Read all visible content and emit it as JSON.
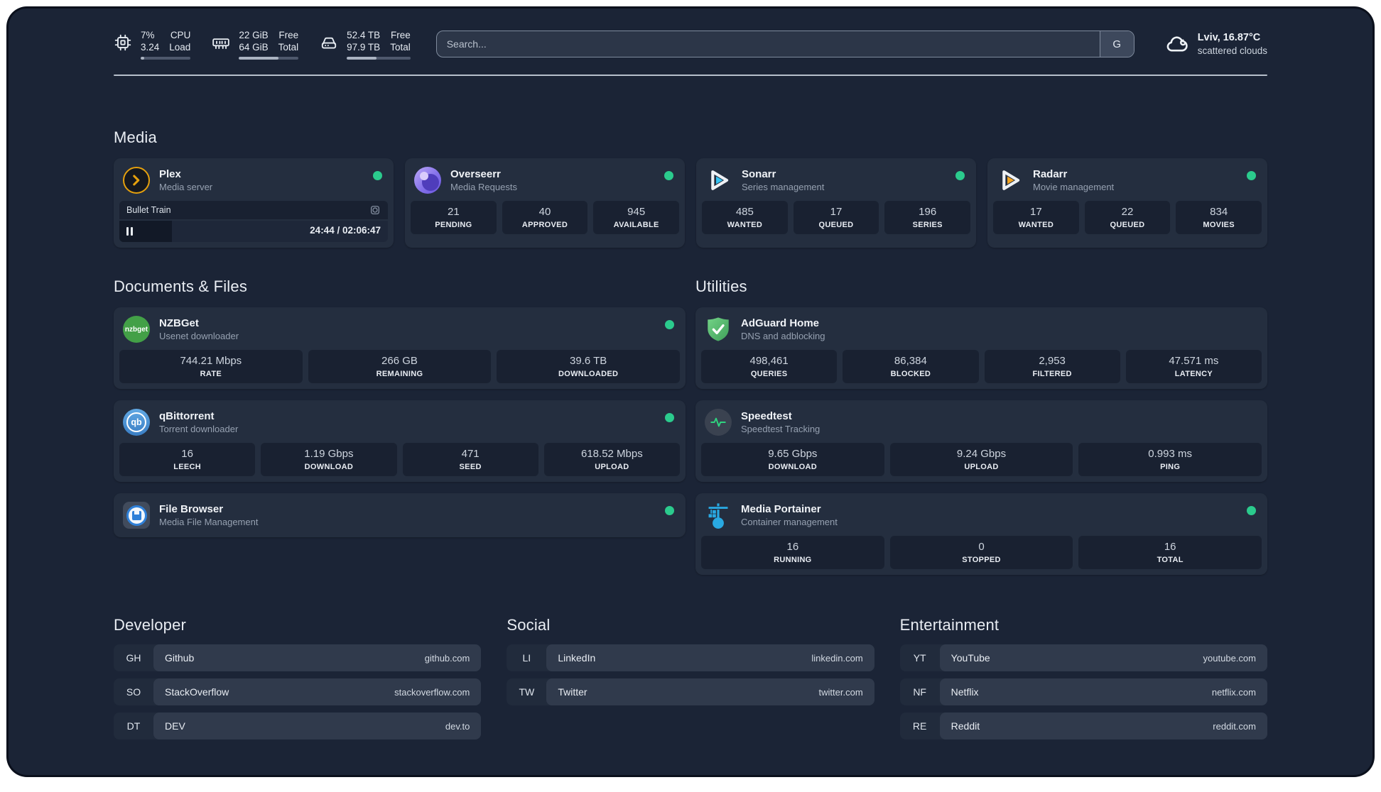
{
  "header": {
    "resources": [
      {
        "v1": "7%",
        "v2": "3.24",
        "l1": "CPU",
        "l2": "Load",
        "pct": 7
      },
      {
        "v1": "22 GiB",
        "v2": "64 GiB",
        "l1": "Free",
        "l2": "Total",
        "pct": 66
      },
      {
        "v1": "52.4 TB",
        "v2": "97.9 TB",
        "l1": "Free",
        "l2": "Total",
        "pct": 47
      }
    ],
    "search": {
      "placeholder": "Search...",
      "provider_label": "G"
    },
    "weather": {
      "location": "Lviv, 16.87°C",
      "condition": "scattered clouds"
    }
  },
  "sections": {
    "media": "Media",
    "documents": "Documents & Files",
    "utilities": "Utilities",
    "developer": "Developer",
    "social": "Social",
    "entertainment": "Entertainment"
  },
  "services": {
    "plex": {
      "name": "Plex",
      "desc": "Media server",
      "status": "online",
      "player": {
        "title": "Bullet Train",
        "time": "24:44 / 02:06:47",
        "progress_pct": 19.5
      }
    },
    "overseerr": {
      "name": "Overseerr",
      "desc": "Media Requests",
      "status": "online",
      "stats": [
        {
          "value": "21",
          "label": "PENDING"
        },
        {
          "value": "40",
          "label": "APPROVED"
        },
        {
          "value": "945",
          "label": "AVAILABLE"
        }
      ]
    },
    "sonarr": {
      "name": "Sonarr",
      "desc": "Series management",
      "status": "online",
      "stats": [
        {
          "value": "485",
          "label": "WANTED"
        },
        {
          "value": "17",
          "label": "QUEUED"
        },
        {
          "value": "196",
          "label": "SERIES"
        }
      ]
    },
    "radarr": {
      "name": "Radarr",
      "desc": "Movie management",
      "status": "online",
      "stats": [
        {
          "value": "17",
          "label": "WANTED"
        },
        {
          "value": "22",
          "label": "QUEUED"
        },
        {
          "value": "834",
          "label": "MOVIES"
        }
      ]
    },
    "nzbget": {
      "name": "NZBGet",
      "desc": "Usenet downloader",
      "status": "online",
      "icon_text": "nzbget",
      "stats": [
        {
          "value": "744.21 Mbps",
          "label": "RATE"
        },
        {
          "value": "266 GB",
          "label": "REMAINING"
        },
        {
          "value": "39.6 TB",
          "label": "DOWNLOADED"
        }
      ]
    },
    "qbittorrent": {
      "name": "qBittorrent",
      "desc": "Torrent downloader",
      "status": "online",
      "icon_text": "qb",
      "stats": [
        {
          "value": "16",
          "label": "LEECH"
        },
        {
          "value": "1.19 Gbps",
          "label": "DOWNLOAD"
        },
        {
          "value": "471",
          "label": "SEED"
        },
        {
          "value": "618.52 Mbps",
          "label": "UPLOAD"
        }
      ]
    },
    "filebrowser": {
      "name": "File Browser",
      "desc": "Media File Management",
      "status": "online"
    },
    "adguard": {
      "name": "AdGuard Home",
      "desc": "DNS and adblocking",
      "status": "",
      "stats": [
        {
          "value": "498,461",
          "label": "QUERIES"
        },
        {
          "value": "86,384",
          "label": "BLOCKED"
        },
        {
          "value": "2,953",
          "label": "FILTERED"
        },
        {
          "value": "47.571 ms",
          "label": "LATENCY"
        }
      ]
    },
    "speedtest": {
      "name": "Speedtest",
      "desc": "Speedtest Tracking",
      "status": "",
      "stats": [
        {
          "value": "9.65 Gbps",
          "label": "DOWNLOAD"
        },
        {
          "value": "9.24 Gbps",
          "label": "UPLOAD"
        },
        {
          "value": "0.993 ms",
          "label": "PING"
        }
      ]
    },
    "portainer": {
      "name": "Media Portainer",
      "desc": "Container management",
      "status": "online",
      "stats": [
        {
          "value": "16",
          "label": "RUNNING"
        },
        {
          "value": "0",
          "label": "STOPPED"
        },
        {
          "value": "16",
          "label": "TOTAL"
        }
      ]
    }
  },
  "bookmarks": {
    "developer": [
      {
        "abbr": "GH",
        "name": "Github",
        "url": "github.com"
      },
      {
        "abbr": "SO",
        "name": "StackOverflow",
        "url": "stackoverflow.com"
      },
      {
        "abbr": "DT",
        "name": "DEV",
        "url": "dev.to"
      }
    ],
    "social": [
      {
        "abbr": "LI",
        "name": "LinkedIn",
        "url": "linkedin.com"
      },
      {
        "abbr": "TW",
        "name": "Twitter",
        "url": "twitter.com"
      }
    ],
    "entertainment": [
      {
        "abbr": "YT",
        "name": "YouTube",
        "url": "youtube.com"
      },
      {
        "abbr": "NF",
        "name": "Netflix",
        "url": "netflix.com"
      },
      {
        "abbr": "RE",
        "name": "Reddit",
        "url": "reddit.com"
      }
    ]
  }
}
